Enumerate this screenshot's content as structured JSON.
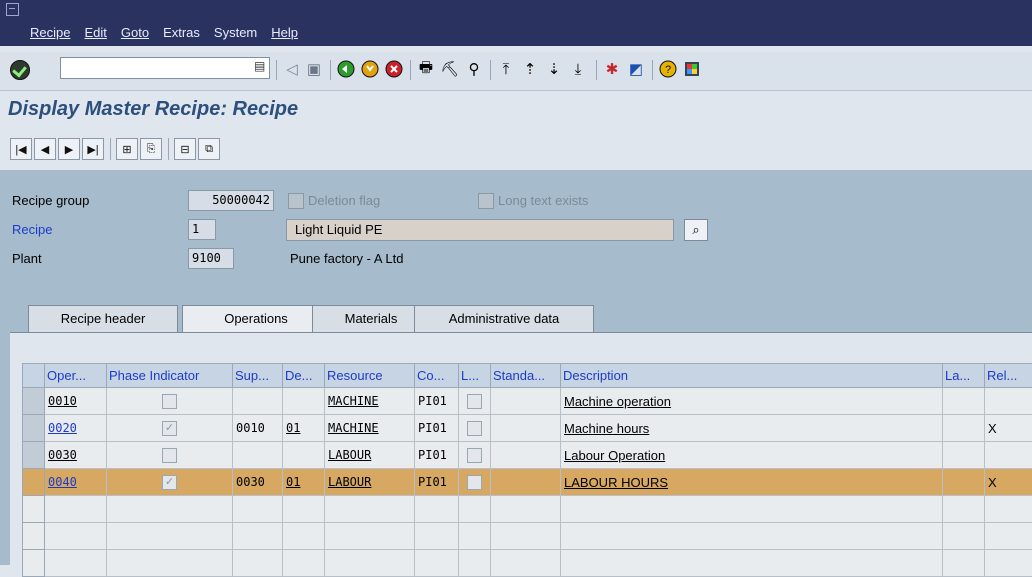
{
  "menubar": {
    "items": [
      {
        "label": "Recipe"
      },
      {
        "label": "Edit"
      },
      {
        "label": "Goto"
      },
      {
        "label": "Extras"
      },
      {
        "label": "System"
      },
      {
        "label": "Help"
      }
    ]
  },
  "toolbar": {
    "command_value": "",
    "icons": [
      "enter-icon",
      "command-field",
      "back-icon",
      "save-icon",
      "back-green-icon",
      "exit-icon",
      "cancel-icon",
      "print-icon",
      "find-icon",
      "find-next-icon",
      "first-page-icon",
      "previous-page-icon",
      "next-page-icon",
      "last-page-icon",
      "create-session-icon",
      "shortcut-icon",
      "help-icon",
      "layout-icon"
    ]
  },
  "page": {
    "title": "Display Master Recipe: Recipe"
  },
  "app_toolbar": {
    "icons": [
      "first-icon",
      "previous-icon",
      "next-icon",
      "last-icon",
      "header-icon",
      "sequences-icon",
      "overview-icon",
      "graphic-icon"
    ]
  },
  "header": {
    "recipe_group_label": "Recipe group",
    "recipe_group_value": "50000042",
    "deletion_flag_label": "Deletion flag",
    "long_text_label": "Long text exists",
    "recipe_label": "Recipe",
    "recipe_value": "1",
    "recipe_desc": "Light Liquid PE",
    "plant_label": "Plant",
    "plant_value": "9100",
    "plant_desc": "Pune factory - A Ltd"
  },
  "tabs": [
    {
      "label": "Recipe header"
    },
    {
      "label": "Operations"
    },
    {
      "label": "Materials"
    },
    {
      "label": "Administrative data"
    }
  ],
  "table": {
    "columns": [
      "Oper...",
      "Phase Indicator",
      "Sup...",
      "De...",
      "Resource",
      "Co...",
      "L...",
      "Standa...",
      "Description",
      "La...",
      "Rel..."
    ],
    "rows": [
      {
        "oper": "0010",
        "phase": false,
        "sup": "",
        "de": "",
        "resource": "MACHINE",
        "co": "PI01",
        "desc": "Machine operation",
        "rel": ""
      },
      {
        "oper": "0020",
        "phase": true,
        "sup": "0010",
        "de": "01",
        "resource": "MACHINE",
        "co": "PI01",
        "desc": "Machine hours",
        "rel": "X"
      },
      {
        "oper": "0030",
        "phase": false,
        "sup": "",
        "de": "",
        "resource": "LABOUR",
        "co": "PI01",
        "desc": "Labour Operation",
        "rel": ""
      },
      {
        "oper": "0040",
        "phase": true,
        "sup": "0030",
        "de": "01",
        "resource": "LABOUR",
        "co": "PI01",
        "desc": "LABOUR HOURS",
        "rel": "X"
      }
    ]
  }
}
